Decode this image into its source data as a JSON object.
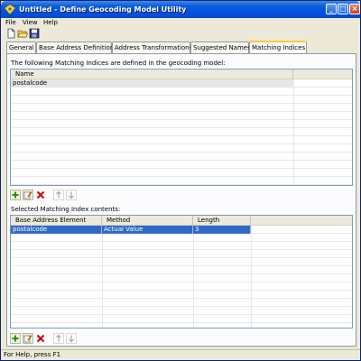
{
  "window": {
    "title": "Untitled - Define Geocoding Model Utility",
    "controls": {
      "minimize": "_",
      "maximize": "□",
      "close": "×"
    }
  },
  "menu": {
    "file": "File",
    "view": "View",
    "help": "Help"
  },
  "toolbar": {
    "icons": [
      "new-document-icon",
      "open-folder-icon",
      "save-disk-icon"
    ]
  },
  "tabs": [
    {
      "label": "General"
    },
    {
      "label": "Base Address Definition"
    },
    {
      "label": "Address Transformations"
    },
    {
      "label": "Suggested Names"
    },
    {
      "label": "Matching Indices",
      "active": true
    }
  ],
  "matching_indices": {
    "label": "The following Matching Indices are defined in the geocoding model:",
    "columns": [
      "Name"
    ],
    "rows": [
      {
        "name": "postalcode"
      }
    ]
  },
  "index_contents": {
    "label": "Selected Matching Index contents:",
    "columns": [
      "Base Address Element",
      "Method",
      "Length"
    ],
    "rows": [
      {
        "element": "postalcode",
        "method": "Actual Value",
        "length": "3",
        "selected": true
      }
    ]
  },
  "row_actions": [
    "add-icon",
    "edit-icon",
    "delete-icon",
    "move-up-icon",
    "move-down-icon"
  ],
  "status_bar": {
    "text": "For Help, press F1"
  },
  "colors": {
    "title_bar": "#0054e3",
    "selection": "#316ac5",
    "active_tab_accent": "#ffc83c",
    "delete": "#cc0000",
    "add": "#2c8a2c"
  }
}
